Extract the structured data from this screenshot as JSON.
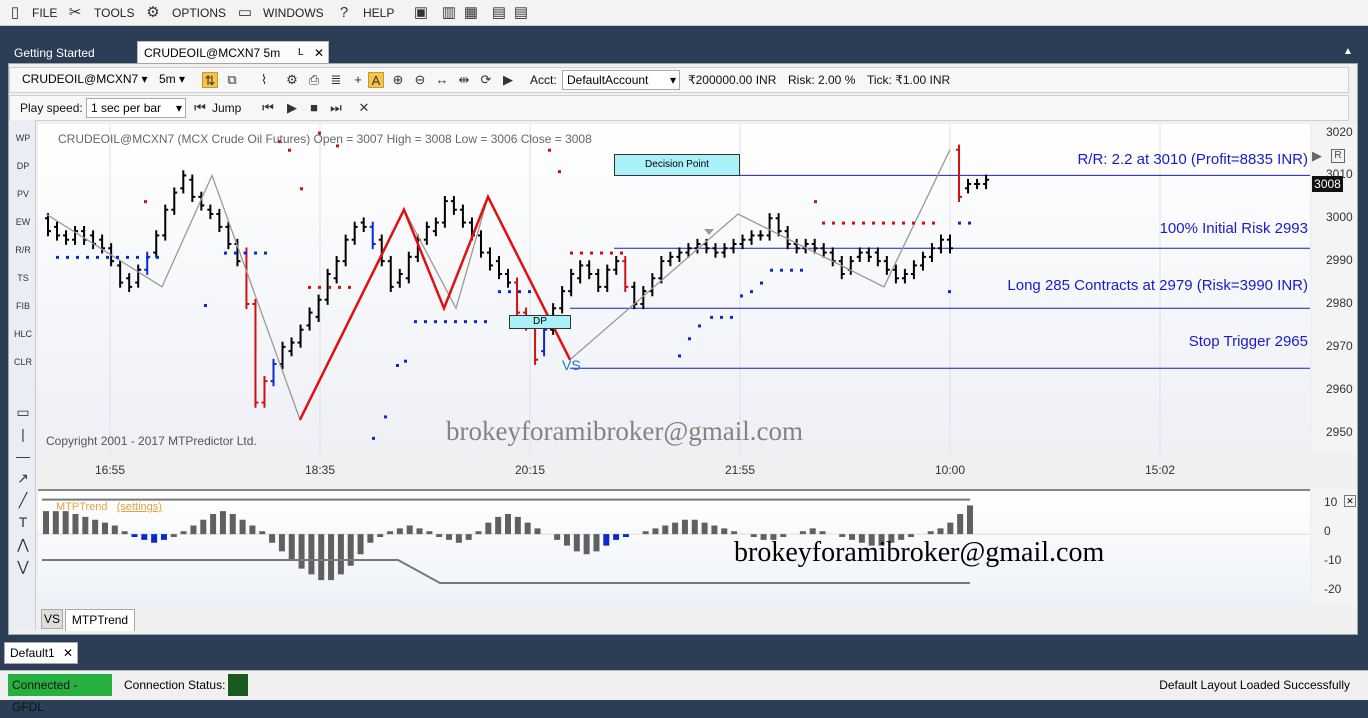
{
  "menu": {
    "file": "FILE",
    "tools": "TOOLS",
    "options": "OPTIONS",
    "windows": "WINDOWS",
    "help": "HELP"
  },
  "tabs": {
    "getting_started": "Getting Started",
    "active": "CRUDEOIL@MCXN7 5m",
    "pin": "L",
    "close": "✕"
  },
  "toolbar1": {
    "symbol": "CRUDEOIL@MCXN7",
    "interval": "5m",
    "acct_label": "Acct:",
    "account": "DefaultAccount",
    "capital": "₹200000.00 INR",
    "risk": "Risk:  2.00 %",
    "tick": "Tick: ₹1.00 INR"
  },
  "toolbar2": {
    "play_speed_label": "Play speed:",
    "speed": "1 sec per bar",
    "jump": "Jump"
  },
  "left_tools": [
    "WP",
    "DP",
    "PV",
    "EW",
    "R/R",
    "TS",
    "FIB",
    "HLC",
    "CLR"
  ],
  "chart": {
    "header": "CRUDEOIL@MCXN7 (MCX Crude Oil Futures) Open = 3007 High = 3008 Low = 3006 Close = 3008",
    "copyright": "Copyright 2001 - 2017 MTPredictor Ltd.",
    "decision_point": "Decision Point",
    "dp": "DP",
    "vs": "VS",
    "rr": "R/R: 2.2 at 3010 (Profit=8835 INR)",
    "initial_risk": "100% Initial Risk 2993",
    "long": "Long 285 Contracts at 2979 (Risk=3990 INR)",
    "stop": "Stop Trigger 2965",
    "last_price": "3008",
    "price_ticks": [
      "3020",
      "3010",
      "3000",
      "2990",
      "2980",
      "2970",
      "2960",
      "2950"
    ],
    "time_ticks": [
      "16:55",
      "18:35",
      "20:15",
      "21:55",
      "10:00",
      "15:02"
    ],
    "watermark": "brokeyforamibroker@gmail.com"
  },
  "chart_data": {
    "type": "candlestick",
    "y_range": [
      2945,
      3022
    ],
    "bars": [
      [
        3000,
        2997
      ],
      [
        2998,
        2996
      ],
      [
        2996,
        2995
      ],
      [
        2995,
        2997
      ],
      [
        2997,
        2995
      ],
      [
        2996,
        2994
      ],
      [
        2995,
        2993
      ],
      [
        2993,
        2990
      ],
      [
        2989,
        2985
      ],
      [
        2986,
        2984
      ],
      [
        2985,
        2988
      ],
      [
        2988,
        2991
      ],
      [
        2992,
        2996
      ],
      [
        2996,
        3002
      ],
      [
        3002,
        3006
      ],
      [
        3007,
        3010
      ],
      [
        3009,
        3005
      ],
      [
        3005,
        3003
      ],
      [
        3002,
        3001
      ],
      [
        3001,
        2998
      ],
      [
        2998,
        2994
      ],
      [
        2994,
        2990
      ],
      [
        2992,
        2980
      ],
      [
        2980,
        2957
      ],
      [
        2957,
        2962
      ],
      [
        2962,
        2966
      ],
      [
        2966,
        2970
      ],
      [
        2969,
        2971
      ],
      [
        2971,
        2974
      ],
      [
        2975,
        2978
      ],
      [
        2977,
        2981
      ],
      [
        2981,
        2987
      ],
      [
        2986,
        2990
      ],
      [
        2990,
        2995
      ],
      [
        2995,
        2998
      ],
      [
        2999,
        2998
      ],
      [
        2998,
        2994
      ],
      [
        2995,
        2990
      ],
      [
        2990,
        2984
      ],
      [
        2985,
        2987
      ],
      [
        2986,
        2991
      ],
      [
        2991,
        2995
      ],
      [
        2995,
        2998
      ],
      [
        2997,
        2999
      ],
      [
        2999,
        3004
      ],
      [
        3004,
        3002
      ],
      [
        3002,
        2999
      ],
      [
        2999,
        2996
      ],
      [
        2996,
        2992
      ],
      [
        2992,
        2989
      ],
      [
        2990,
        2987
      ],
      [
        2987,
        2985
      ],
      [
        2985,
        2978
      ],
      [
        2978,
        2975
      ],
      [
        2975,
        2967
      ],
      [
        2969,
        2974
      ],
      [
        2974,
        2979
      ],
      [
        2979,
        2983
      ],
      [
        2983,
        2987
      ],
      [
        2986,
        2989
      ],
      [
        2989,
        2987
      ],
      [
        2987,
        2984
      ],
      [
        2984,
        2988
      ],
      [
        2988,
        2990
      ],
      [
        2990,
        2984
      ],
      [
        2984,
        2980
      ],
      [
        2980,
        2983
      ],
      [
        2983,
        2986
      ],
      [
        2986,
        2990
      ],
      [
        2990,
        2991
      ],
      [
        2991,
        2992
      ],
      [
        2992,
        2993
      ],
      [
        2993,
        2994
      ],
      [
        2994,
        2993
      ],
      [
        2993,
        2992
      ],
      [
        2992,
        2993
      ],
      [
        2993,
        2994
      ],
      [
        2994,
        2995
      ],
      [
        2995,
        2996
      ],
      [
        2996,
        2996
      ],
      [
        2996,
        3000
      ],
      [
        3000,
        2997
      ],
      [
        2997,
        2994
      ],
      [
        2994,
        2993
      ],
      [
        2993,
        2994
      ],
      [
        2994,
        2993
      ],
      [
        2993,
        2992
      ],
      [
        2992,
        2990
      ],
      [
        2990,
        2987
      ],
      [
        2988,
        2990
      ],
      [
        2991,
        2992
      ],
      [
        2992,
        2991
      ],
      [
        2992,
        2990
      ],
      [
        2990,
        2988
      ],
      [
        2988,
        2986
      ],
      [
        2986,
        2987
      ],
      [
        2987,
        2989
      ],
      [
        2989,
        2991
      ],
      [
        2991,
        2993
      ],
      [
        2993,
        2995
      ],
      [
        2995,
        2993
      ],
      [
        3016,
        3005
      ],
      [
        3007,
        3008
      ],
      [
        3008,
        3008
      ],
      [
        3008,
        3009
      ]
    ],
    "levels": {
      "target": 3010,
      "initial_risk": 2993,
      "entry": 2979,
      "stop": 2965
    },
    "indicator": {
      "name": "MTPTrend",
      "settings": "(settings)",
      "y_range": [
        -25,
        15
      ],
      "ticks": [
        "10",
        "0",
        "-10",
        "-20"
      ],
      "values": [
        8,
        8,
        8,
        7,
        6,
        5,
        4,
        3,
        1,
        -1,
        -2,
        -3,
        -2,
        -1,
        1,
        3,
        5,
        7,
        8,
        7,
        5,
        3,
        1,
        -3,
        -6,
        -9,
        -12,
        -14,
        -16,
        -16,
        -14,
        -11,
        -7,
        -3,
        -1,
        1,
        2,
        3,
        2,
        1,
        -1,
        -2,
        -3,
        -2,
        1,
        4,
        6,
        7,
        6,
        4,
        2,
        0,
        -2,
        -4,
        -6,
        -7,
        -6,
        -4,
        -2,
        -1,
        0,
        1,
        2,
        3,
        4,
        5,
        5,
        4,
        3,
        2,
        1,
        0,
        -1,
        -2,
        -2,
        -1,
        0,
        1,
        2,
        1,
        0,
        -1,
        -2,
        -3,
        -4,
        -4,
        -3,
        -2,
        -1,
        0,
        1,
        2,
        4,
        7,
        10
      ]
    }
  },
  "bottom_tabs": {
    "vs": "VS",
    "mtptrend": "MTPTrend"
  },
  "doc_tab": "Default1",
  "status": {
    "connected": "Connected - GFDL",
    "connection_label": "Connection Status:",
    "layout": "Default Layout Loaded Successfully"
  }
}
